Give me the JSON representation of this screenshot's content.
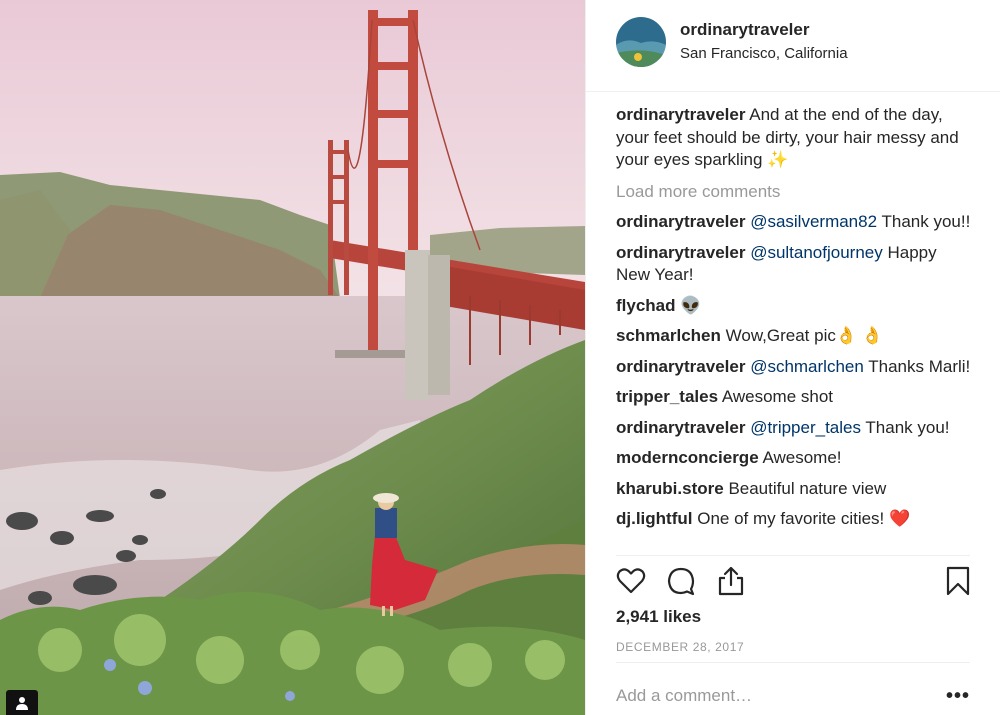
{
  "post": {
    "username": "ordinarytraveler",
    "location": "San Francisco, California",
    "caption": {
      "author": "ordinarytraveler",
      "text": "And at the end of the day, your feet should be dirty, your hair messy and your eyes sparkling",
      "emoji": "✨"
    },
    "load_more_label": "Load more comments",
    "comments": [
      {
        "author": "ordinarytraveler",
        "mention": "@sasilverman82",
        "text": "Thank you!!"
      },
      {
        "author": "ordinarytraveler",
        "mention": "@sultanofjourney",
        "text": "Happy New Year!"
      },
      {
        "author": "flychad",
        "mention": "",
        "text": "👽"
      },
      {
        "author": "schmarlchen",
        "mention": "",
        "text": "Wow,Great pic👌 👌"
      },
      {
        "author": "ordinarytraveler",
        "mention": "@schmarlchen",
        "text": "Thanks Marli!"
      },
      {
        "author": "tripper_tales",
        "mention": "",
        "text": "Awesome shot"
      },
      {
        "author": "ordinarytraveler",
        "mention": "@tripper_tales",
        "text": "Thank you!"
      },
      {
        "author": "modernconcierge",
        "mention": "",
        "text": "Awesome!"
      },
      {
        "author": "kharubi.store",
        "mention": "",
        "text": "Beautiful nature view"
      },
      {
        "author": "dj.lightful",
        "mention": "",
        "text": "One of my favorite cities! ❤️"
      }
    ],
    "likes": "2,941 likes",
    "date": "DECEMBER 28, 2017",
    "add_comment_placeholder": "Add a comment…",
    "more_options_label": "•••"
  },
  "icons": {
    "like": "heart-icon",
    "comment": "comment-bubble-icon",
    "share": "share-icon",
    "save": "bookmark-icon",
    "badge": "user-tag-icon"
  },
  "colors": {
    "text": "#262626",
    "muted": "#999999",
    "mention": "#003569",
    "bridge": "#c0463a"
  }
}
